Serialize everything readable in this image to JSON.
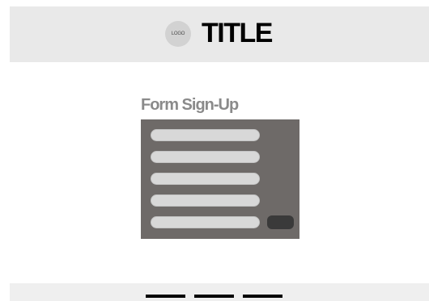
{
  "header": {
    "logo_text": "LOGO",
    "title": "TITLE"
  },
  "form": {
    "heading": "Form Sign-Up",
    "fields": [
      "",
      "",
      "",
      "",
      ""
    ],
    "submit_label": ""
  },
  "footer": {
    "links": [
      "",
      "",
      ""
    ]
  },
  "colors": {
    "header_bg": "#e9e9e9",
    "panel_bg": "#6e6a68",
    "field_bg": "#d8d8d8",
    "submit_bg": "#3a3a3a",
    "footer_bg": "#efefef"
  }
}
